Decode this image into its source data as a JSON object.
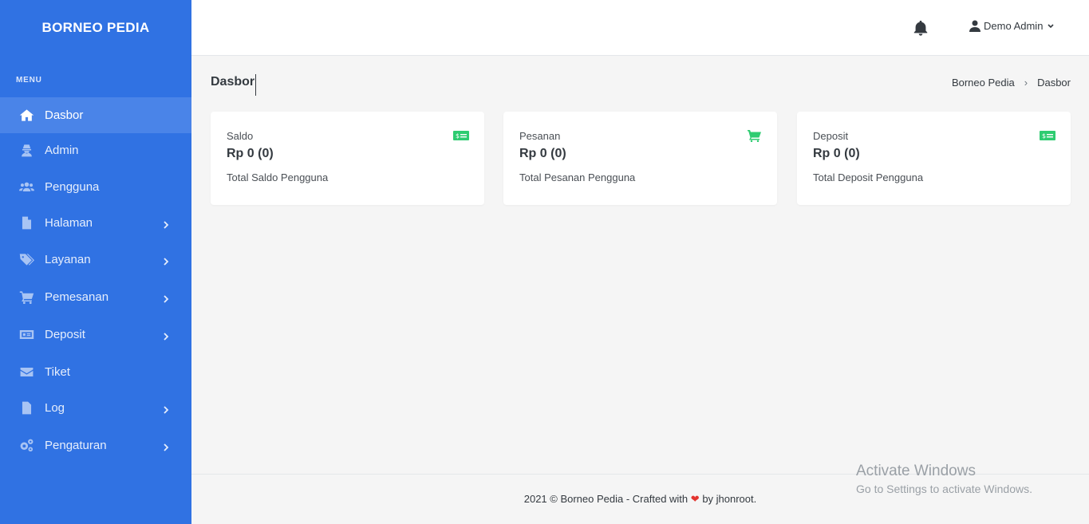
{
  "brand": "BORNEO PEDIA",
  "menu_title": "MENU",
  "sidebar": {
    "items": [
      {
        "label": "Dasbor"
      },
      {
        "label": "Admin"
      },
      {
        "label": "Pengguna"
      },
      {
        "label": "Halaman"
      },
      {
        "label": "Layanan"
      },
      {
        "label": "Pemesanan"
      },
      {
        "label": "Deposit"
      },
      {
        "label": "Tiket"
      },
      {
        "label": "Log"
      },
      {
        "label": "Pengaturan"
      }
    ],
    "active_item": "Dasbor"
  },
  "topbar": {
    "user_name": "Demo Admin",
    "bell_icon": "bell-icon",
    "user_icon": "user-icon"
  },
  "page": {
    "title": "Dasbor",
    "breadcrumb": [
      "Borneo Pedia",
      "Dasbor"
    ],
    "breadcrumb_separator": "›"
  },
  "cards": [
    {
      "label": "Saldo",
      "value": "Rp 0 (0)",
      "subtitle": "Total Saldo Pengguna",
      "icon": "money-bill-icon"
    },
    {
      "label": "Pesanan",
      "value": "Rp 0 (0)",
      "subtitle": "Total Pesanan Pengguna",
      "icon": "shopping-cart-icon"
    },
    {
      "label": "Deposit",
      "value": "Rp 0 (0)",
      "subtitle": "Total Deposit Pengguna",
      "icon": "money-bill-icon"
    }
  ],
  "footer": {
    "prefix": "2021 © Borneo Pedia - Crafted with",
    "heart": "❤",
    "suffix": "by jhonroot."
  },
  "watermark": {
    "title": "Activate Windows",
    "subtitle": "Go to Settings to activate Windows."
  },
  "colors": {
    "sidebar": "#3072e3",
    "sidebar_active": "#4a84e8",
    "card_icon": "#2ecc71",
    "heart": "#e3342f"
  }
}
